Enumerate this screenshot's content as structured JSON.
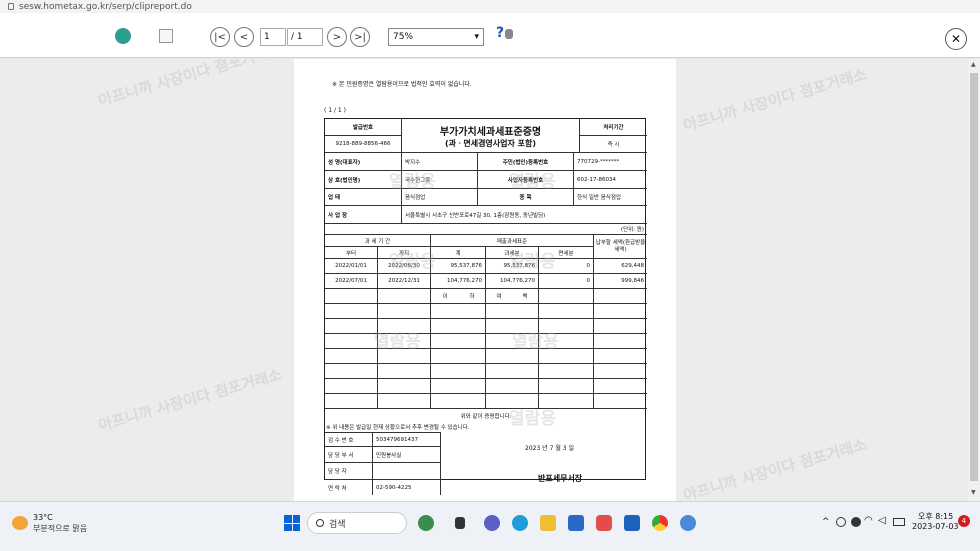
{
  "browser": {
    "url": "sesw.hometax.go.kr/serp/clipreport.do"
  },
  "toolbar": {
    "page_current": "1",
    "page_total": "/ 1",
    "zoom": "75%",
    "help": "?"
  },
  "doc": {
    "notice": "※ 본 민원증명은 열람용이므로 법적인 효력이 없습니다.",
    "page_count": "( 1 / 1 )",
    "issue_no_label": "발급번호",
    "issue_no": "9218-889-8856-466",
    "title": "부가가치세과세표준증명",
    "subtitle": "(과ㆍ면세겸영사업자 포함)",
    "proc_label": "처리기간",
    "proc_value": "즉 시",
    "name_label": "성 명(대표자)",
    "name_value": "박지수",
    "rrn_label": "주민(법인)등록번호",
    "rrn_value": "770729-*******",
    "biz_label": "상 호(법인명)",
    "biz_value": "국수한그릇",
    "bizno_label": "사업자등록번호",
    "bizno_value": "602-17-86034",
    "type_label": "업 태",
    "type_value": "음식점업",
    "item_label": "종 목",
    "item_value": "한식 일반 음식점업",
    "addr_label": "사 업 장",
    "addr_value": "서울특별시 서초구 신반포로47길 30, 1층(잠원동, 동년빌딩)",
    "unit": "(단위: 원)",
    "period_header": "과 세 기 간",
    "start_header": "부터",
    "end_header": "까지",
    "sales_header": "매출과세표준",
    "total_header": "계",
    "taxable_header": "과세분",
    "exempt_header": "면세분",
    "paid_header": "납부할 세액(환급받을 세액)",
    "rows": [
      {
        "start": "2022/01/01",
        "end": "2022/06/30",
        "total": "95,537,876",
        "taxable": "95,537,876",
        "exempt": "0",
        "paid": "629,448"
      },
      {
        "start": "2022/07/01",
        "end": "2022/12/31",
        "total": "104,776,270",
        "taxable": "104,776,270",
        "exempt": "0",
        "paid": "999,846"
      }
    ],
    "blank_row": [
      "이",
      "하",
      "여",
      "백"
    ],
    "certify": "위와 같이 증명합니다.",
    "warning": "※ 위 내용은 발급일 현재 상황으로서 추후 변경될 수 있습니다.",
    "date": "2023 년 7 월 3 일",
    "office": "반포세무서장",
    "inspect_no_label": "검 수 번 호",
    "inspect_no": "503479691437",
    "dept_label": "담 당 부 서",
    "dept_value": "민원봉사실",
    "staff_label": "담 당 자",
    "staff_value": "",
    "tel_label": "연 락 처",
    "tel_value": "02-590-4225",
    "watermark_read": "열람용",
    "watermark_banner": "아프니까 사장이다 점포거래소"
  },
  "taskbar": {
    "temp": "33°C",
    "weather": "부분적으로 맑음",
    "search": "검색",
    "time": "오후 8:15",
    "date": "2023-07-03",
    "notif": "4"
  }
}
